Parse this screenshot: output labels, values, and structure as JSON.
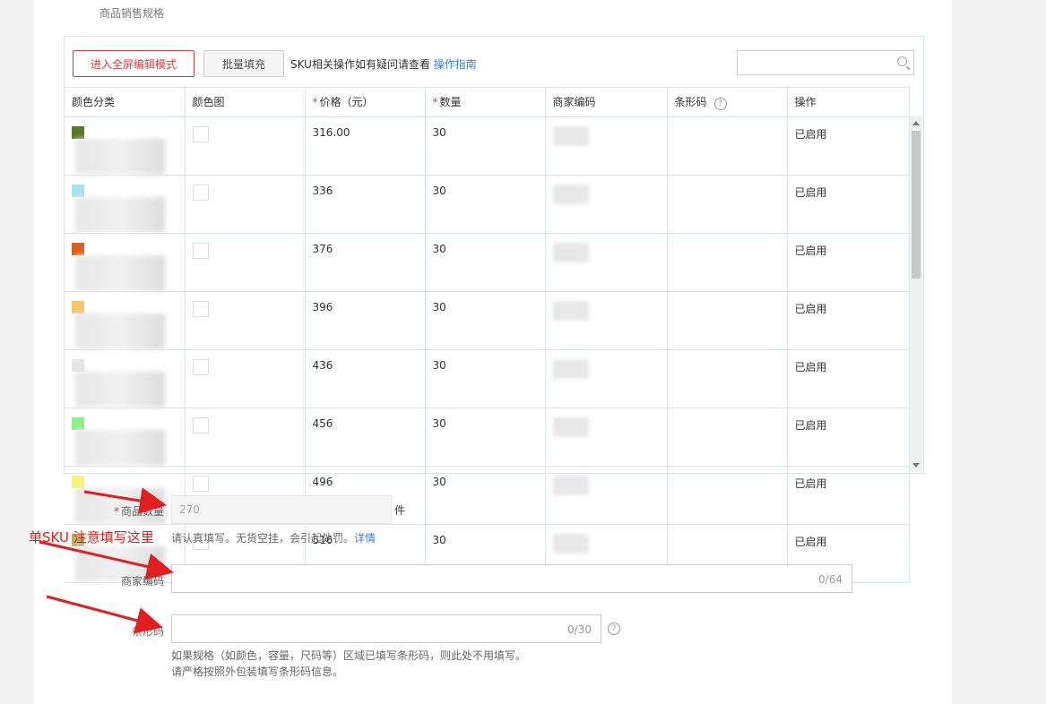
{
  "section_title": "商品销售规格",
  "toolbar": {
    "fullscreen_button": "进入全屏编辑模式",
    "batch_fill_button": "批量填充",
    "hint_text": "SKU相关操作如有疑问请查看",
    "guide_link": "操作指南",
    "search_placeholder": ""
  },
  "table": {
    "headers": [
      "颜色分类",
      "颜色图",
      "价格（元）",
      "数量",
      "商家编码",
      "条形码",
      "操作"
    ],
    "rows": [
      {
        "color": "#5a7a2a",
        "price": "316.00",
        "qty": "30",
        "status": "已启用"
      },
      {
        "color": "#a8e4f0",
        "price": "336",
        "qty": "30",
        "status": "已启用"
      },
      {
        "color": "#d9621c",
        "price": "376",
        "qty": "30",
        "status": "已启用"
      },
      {
        "color": "#f7c46b",
        "price": "396",
        "qty": "30",
        "status": "已启用"
      },
      {
        "color": "#e4e4e4",
        "price": "436",
        "qty": "30",
        "status": "已启用"
      },
      {
        "color": "#8ef08a",
        "price": "456",
        "qty": "30",
        "status": "已启用"
      },
      {
        "color": "#f4f477",
        "price": "496",
        "qty": "30",
        "status": "已启用"
      },
      {
        "color": "#b7b066",
        "price": "516",
        "qty": "30",
        "status": "已启用"
      }
    ]
  },
  "form": {
    "quantity_label": "商品数量",
    "quantity_value": "270",
    "quantity_unit": "件",
    "quantity_hint": "请认真填写。无货空挂，会引起处罚。",
    "quantity_hint_link": "详情",
    "merchant_code_label": "商家编码",
    "merchant_code_counter": "0/64",
    "barcode_label": "条形码",
    "barcode_counter": "0/30",
    "barcode_hint_1": "如果规格（如颜色，容量，尺码等）区域已填写条形码，则此处不用填写。",
    "barcode_hint_2": "请严格按照外包装填写条形码信息。"
  },
  "annotation": {
    "note_text": "单SKU 注意填写这里",
    "arrow_color": "#e02020"
  }
}
